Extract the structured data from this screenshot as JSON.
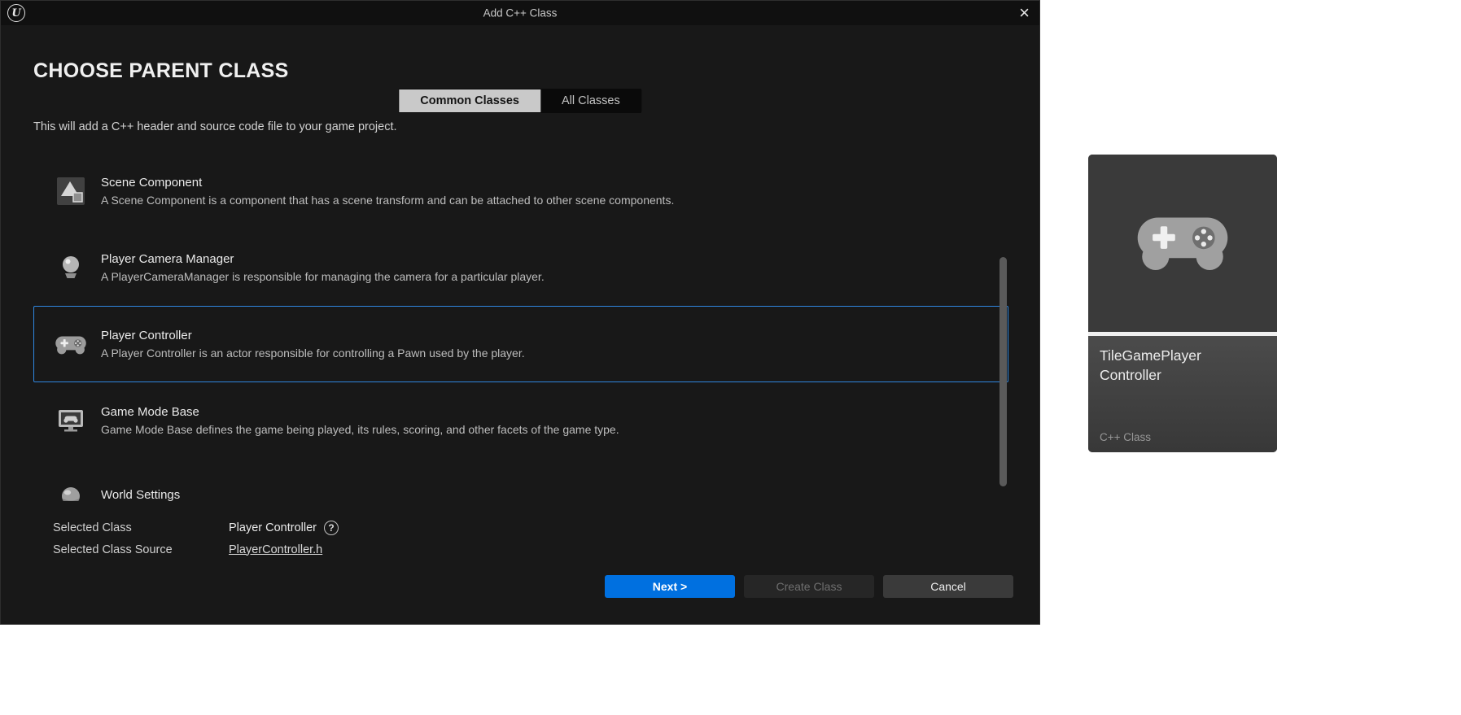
{
  "window": {
    "title": "Add C++ Class",
    "close_glyph": "×",
    "logo_letter": "U"
  },
  "header": {
    "title": "CHOOSE PARENT CLASS",
    "tabs": [
      {
        "label": "Common Classes",
        "selected": true
      },
      {
        "label": "All Classes",
        "selected": false
      }
    ],
    "description": "This will add a C++ header and source code file to your game project."
  },
  "class_list": [
    {
      "name": "Scene Component",
      "description": "A Scene Component is a component that has a scene transform and can be attached to other scene components.",
      "icon": "scene-component-icon",
      "selected": false
    },
    {
      "name": "Player Camera Manager",
      "description": "A PlayerCameraManager is responsible for managing the camera for a particular player.",
      "icon": "camera-manager-icon",
      "selected": false
    },
    {
      "name": "Player Controller",
      "description": "A Player Controller is an actor responsible for controlling a Pawn used by the player.",
      "icon": "gamepad-icon",
      "selected": true
    },
    {
      "name": "Game Mode Base",
      "description": "Game Mode Base defines the game being played, its rules, scoring, and other facets of the game type.",
      "icon": "game-mode-icon",
      "selected": false
    },
    {
      "name": "World Settings",
      "description": "",
      "icon": "world-settings-icon",
      "selected": false
    }
  ],
  "footer": {
    "selected_class_label": "Selected Class",
    "selected_class_value": "Player Controller",
    "help_glyph": "?",
    "selected_class_source_label": "Selected Class Source",
    "selected_class_source_value": "PlayerController.h",
    "next_label": "Next >",
    "create_label": "Create Class",
    "cancel_label": "Cancel"
  },
  "asset_card": {
    "name_lines": [
      "TileGamePlayer",
      "Controller"
    ],
    "type_label": "C++ Class"
  },
  "colors": {
    "accent": "#0070e0",
    "selection_border": "#2f87e0"
  }
}
